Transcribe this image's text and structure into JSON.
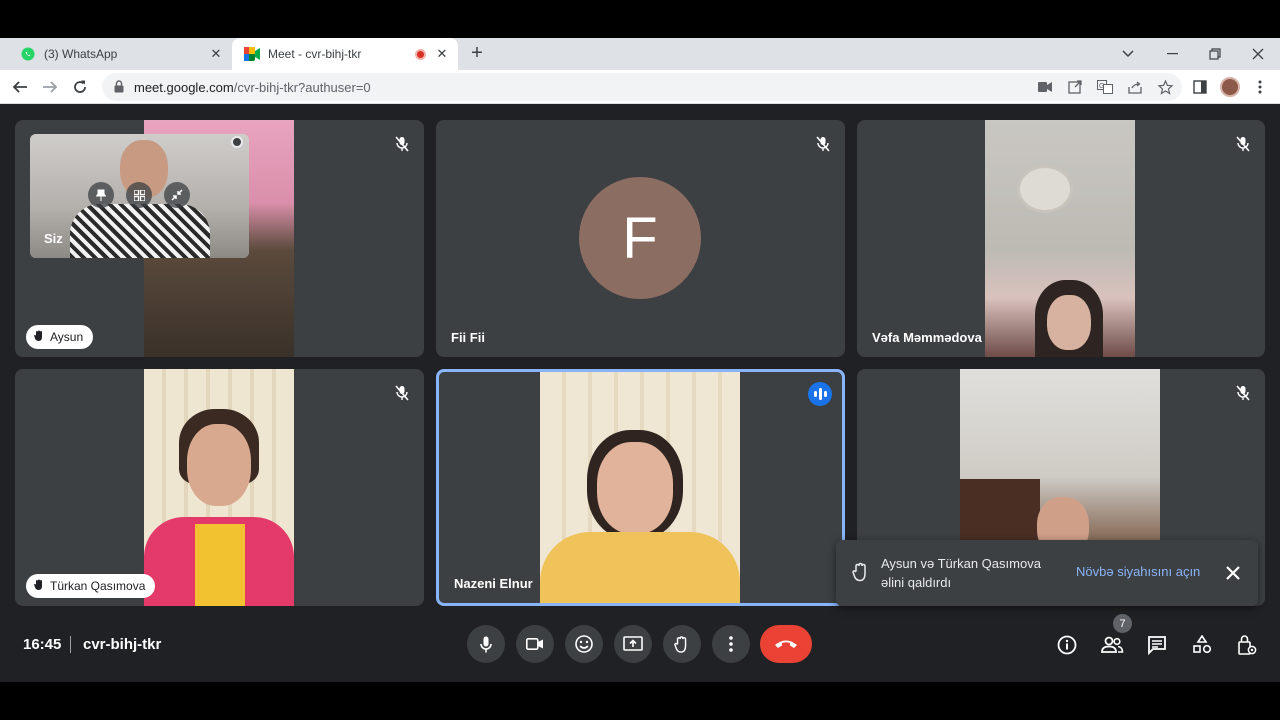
{
  "browser": {
    "tabs": [
      {
        "title": "(3) WhatsApp",
        "favicon": "whatsapp-icon"
      },
      {
        "title": "Meet - cvr-bihj-tkr",
        "favicon": "google-meet-icon",
        "recording": true
      }
    ],
    "url_host": "meet.google.com",
    "url_path": "/cvr-bihj-tkr?authuser=0"
  },
  "participants": [
    {
      "name": "Aysun",
      "hand_raised": true,
      "muted": true
    },
    {
      "name": "Fii Fii",
      "avatar_letter": "F",
      "avatar_color": "#8c6d62",
      "muted": true
    },
    {
      "name": "Vəfa Məmmədova",
      "muted": true
    },
    {
      "name": "Türkan Qasımova",
      "hand_raised": true,
      "muted": true
    },
    {
      "name": "Nazeni Elnur",
      "speaking": true
    },
    {
      "name": "",
      "muted": true
    }
  ],
  "self_view": {
    "label": "Siz"
  },
  "toast": {
    "message": "Aysun və Türkan Qasımova əlini qaldırdı",
    "link": "Növbə siyahısını açın"
  },
  "meeting": {
    "time": "16:45",
    "code": "cvr-bihj-tkr"
  },
  "people_count": "7",
  "colors": {
    "meet_bg": "#202124",
    "tile_bg": "#3c4043",
    "hangup": "#ea4335",
    "accent": "#1a73e8",
    "link": "#8ab4f8"
  }
}
